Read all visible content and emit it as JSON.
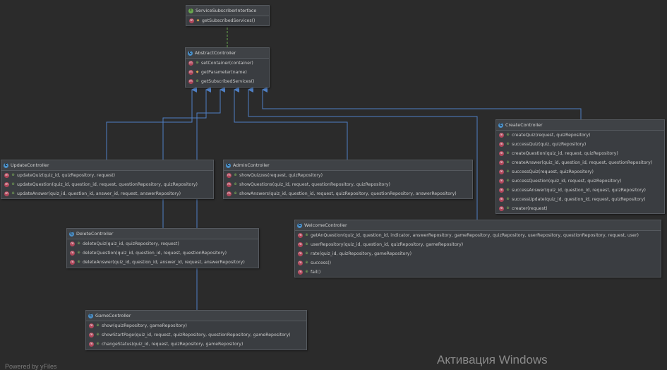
{
  "nodes": {
    "service": {
      "title": "ServiceSubscriberInterface",
      "methods": [
        "getSubscribedServices()"
      ]
    },
    "abstract": {
      "title": "AbstractController",
      "methods": [
        "setContainer(container)",
        "getParameter(name)",
        "getSubscribedServices()"
      ]
    },
    "update": {
      "title": "UpdateController",
      "methods": [
        "updateQuiz(quiz_id, quizRepository, request)",
        "updateQuestion(quiz_id, question_id, request, questionRepository, quizRepository)",
        "updateAnswer(quiz_id, question_id, answer_id, request, answerRepository)"
      ]
    },
    "admin": {
      "title": "AdminController",
      "methods": [
        "showQuizzes(request, quizRepository)",
        "showQuestions(quiz_id, request, questionRepository, quizRepository)",
        "showAnswers(quiz_id, question_id, request, quizRepository, questionRepository, answerRepository)"
      ]
    },
    "create": {
      "title": "CreateController",
      "methods": [
        "createQuiz(request, quizRepository)",
        "successQuiz(quiz, quizRepository)",
        "createQuestion(quiz_id, request, quizRepository)",
        "createAnswer(quiz_id, question_id, request, questionRepository)",
        "successQuiz(request, quizRepository)",
        "successQuestion(quiz_id, request, quizRepository)",
        "successAnswer(quiz_id, question_id, request, quizRepository)",
        "successUpdate(quiz_id, question_id, request, quizRepository)",
        "creater(request)"
      ]
    },
    "delete": {
      "title": "DeleteController",
      "methods": [
        "deleteQuiz(quiz_id, quizRepository, request)",
        "deleteQuestion(quiz_id, question_id, request, questionRepository)",
        "deleteAnswer(quiz_id, question_id, answer_id, request, answerRepository)"
      ]
    },
    "welcome": {
      "title": "WelcomeController",
      "methods": [
        "getAnQuestion(quiz_id, question_id, indicator, answerRepository, gameRepository, quizRepository, userRepository, questionRepository, request, user)",
        "userRepository(quiz_id, question_id, quizRepository, gameRepository)",
        "rate(quiz_id, quizRepository, gameRepository)",
        "success()",
        "fail()"
      ]
    },
    "game": {
      "title": "GameController",
      "methods": [
        "show(quizRepository, gameRepository)",
        "showStartPage(quiz_id, request, quizRepository, questionRepository, gameRepository)",
        "changeStatus(quiz_id, request, quizRepository, gameRepository)"
      ]
    }
  },
  "watermark": "Активация Windows",
  "credit": "Powered by yFiles",
  "colors": {
    "background": "#2b2b2b",
    "edge_inheritance": "#4f7fc4",
    "edge_interface": "#6aa84f",
    "method_icon": "#b0465a"
  }
}
